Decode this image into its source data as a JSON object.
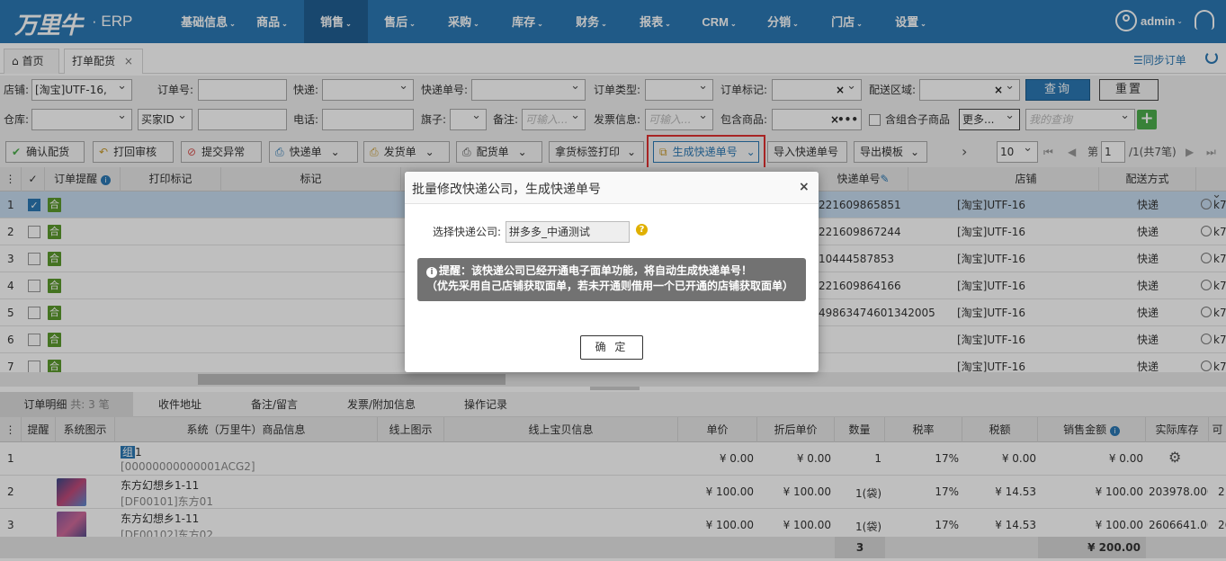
{
  "topnav": {
    "logo": "万里牛",
    "logo_suffix": "· ERP",
    "menu": [
      "基础信息",
      "商品",
      "销售",
      "售后",
      "采购",
      "库存",
      "财务",
      "报表",
      "CRM",
      "分销",
      "门店",
      "设置"
    ],
    "active_index": 2,
    "user": "admin"
  },
  "tabs": [
    {
      "label": "首页"
    },
    {
      "label": "打单配货",
      "close": "×"
    }
  ],
  "sync_orders": "☰同步订单",
  "filters": {
    "shop_label": "店铺:",
    "shop_value": "[淘宝]UTF-16,",
    "order_no_label": "订单号:",
    "express_label": "快递:",
    "express_no_label": "快递单号:",
    "order_type_label": "订单类型:",
    "order_flag_label": "订单标记:",
    "order_flag_clear": "×",
    "region_label": "配送区域:",
    "region_clear": "×",
    "query_btn": "查询",
    "reset_btn": "重置",
    "warehouse_label": "仓库:",
    "buyer_id_select": "买家ID",
    "phone_label": "电话:",
    "flag_label": "旗子:",
    "remark_label": "备注:",
    "remark_placeholder": "可输入...",
    "invoice_label": "发票信息:",
    "invoice_placeholder": "可输入...",
    "goods_label": "包含商品:",
    "goods_clear": "×",
    "goods_more": "•••",
    "combo_label": "含组合子商品",
    "more_btn": "更多...",
    "my_query_placeholder": "我的查询",
    "add_btn": "+"
  },
  "toolbar": {
    "confirm": "确认配货",
    "print_back": "打回审核",
    "submit_exception": "提交异常",
    "express_slip": "快递单",
    "delivery_slip": "发货单",
    "picking_slip": "配货单",
    "goods_label_print": "拿货标签打印",
    "gen_express_no": "生成快递单号",
    "import_express_no": "导入快递单号",
    "export_template": "导出模板",
    "next": "›",
    "page_size": "10",
    "first": "⏮",
    "prev": "◀",
    "page_prefix": "第",
    "page_no": "1",
    "page_suffix": "/1(共7笔)",
    "next_page": "▶",
    "last": "⏭"
  },
  "grid": {
    "headers": {
      "menu": "⋮",
      "check": "✓",
      "order_remind": "订单提醒",
      "print_flag": "打印标记",
      "flag": "标记",
      "express_no": "快递单号",
      "shop": "店铺",
      "delivery": "配送方式"
    },
    "badge": "合",
    "rows": [
      {
        "no": "1",
        "express_no": "221609865851",
        "shop": "[淘宝]UTF-16",
        "delivery": "快递",
        "tail": "k7",
        "checked": "✓"
      },
      {
        "no": "2",
        "express_no": "221609867244",
        "shop": "[淘宝]UTF-16",
        "delivery": "快递",
        "tail": "k7",
        "checked": ""
      },
      {
        "no": "3",
        "express_no": "10444587853",
        "shop": "[淘宝]UTF-16",
        "delivery": "快递",
        "tail": "k7",
        "checked": ""
      },
      {
        "no": "4",
        "express_no": "221609864166",
        "shop": "[淘宝]UTF-16",
        "delivery": "快递",
        "tail": "k7",
        "checked": ""
      },
      {
        "no": "5",
        "express_no": "49863474601342005",
        "shop": "[淘宝]UTF-16",
        "delivery": "快递",
        "tail": "k7",
        "checked": ""
      },
      {
        "no": "6",
        "express_no": "",
        "shop": "[淘宝]UTF-16",
        "delivery": "快递",
        "tail": "k7",
        "checked": ""
      },
      {
        "no": "7",
        "express_no": "",
        "shop": "[淘宝]UTF-16",
        "delivery": "快递",
        "tail": "k7",
        "checked": ""
      }
    ]
  },
  "bottom_tabs": {
    "detail": "订单明细",
    "detail_count": "共: 3 笔",
    "address": "收件地址",
    "remark": "备注/留言",
    "invoice": "发票/附加信息",
    "log": "操作记录"
  },
  "detail_grid": {
    "headers": {
      "menu": "⋮",
      "remind": "提醒",
      "sys_img": "系统图示",
      "sys_info": "系统（万里牛）商品信息",
      "online_img": "线上图示",
      "online_info": "线上宝贝信息",
      "price": "单价",
      "disc_price": "折后单价",
      "qty": "数量",
      "tax_rate": "税率",
      "tax": "税额",
      "sales_amount": "销售金额",
      "stock": "实际库存",
      "avail": "可"
    },
    "rows": [
      {
        "no": "1",
        "tag": "组",
        "name": "1",
        "code": "[00000000000001ACG2]",
        "price": "¥ 0.00",
        "disc": "¥ 0.00",
        "qty": "1",
        "rate": "17%",
        "tax": "¥ 0.00",
        "amount": "¥ 0.00",
        "stock": "",
        "avail": ""
      },
      {
        "no": "2",
        "tag": "",
        "name": "东方幻想乡1-11",
        "code": "[DF00101]东方01",
        "price": "¥ 100.00",
        "disc": "¥ 100.00",
        "qty": "1(袋)",
        "rate": "17%",
        "tax": "¥ 14.53",
        "amount": "¥ 100.00",
        "stock": "203978.000",
        "avail": "2"
      },
      {
        "no": "3",
        "tag": "",
        "name": "东方幻想乡1-11",
        "code": "[DF00102]东方02",
        "price": "¥ 100.00",
        "disc": "¥ 100.00",
        "qty": "1(袋)",
        "rate": "17%",
        "tax": "¥ 14.53",
        "amount": "¥ 100.00",
        "stock": "2606641.00",
        "avail": "26"
      }
    ],
    "total_qty": "3",
    "total_amount": "¥ 200.00"
  },
  "modal": {
    "title": "批量修改快递公司，生成快递单号",
    "close": "×",
    "company_label": "选择快递公司:",
    "company_value": "拼多多_中通测试",
    "help": "?",
    "alert_line1": "提醒：该快递公司已经开通电子面单功能，将自动生成快递单号！",
    "alert_line2": "（优先采用自己店铺获取面单，若未开通则借用一个已开通的店铺获取面单）",
    "ok": "确 定"
  },
  "colors": {
    "nav": "#2b79b5",
    "active_nav": "#215f93",
    "badge": "#5b9a2c",
    "highlight": "#e03030"
  }
}
